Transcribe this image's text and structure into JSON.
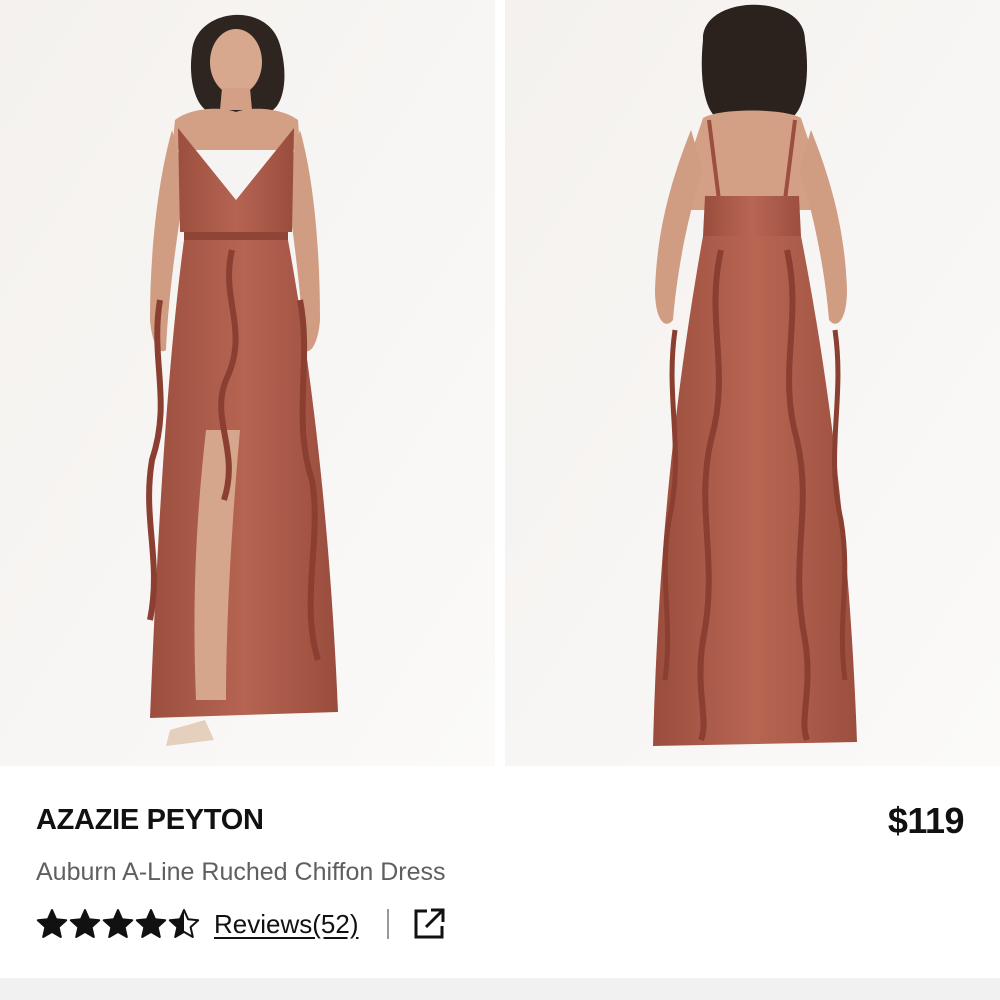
{
  "product": {
    "brand": "AZAZIE PEYTON",
    "price": "$119",
    "subtitle": "Auburn A-Line Ruched Chiffon Dress"
  },
  "gallery": {
    "images": [
      {
        "view": "front",
        "label": "Model wearing auburn dress, front view"
      },
      {
        "view": "back",
        "label": "Model wearing auburn dress, back view"
      }
    ]
  },
  "rating": {
    "value": 4.5,
    "max": 5,
    "reviews_label": "Reviews(52)"
  },
  "icons": {
    "star": "star-icon",
    "share": "external-link-icon"
  },
  "colors": {
    "dress": "#b05e4c",
    "text": "#111111",
    "subtitle": "#5f5f5f"
  }
}
